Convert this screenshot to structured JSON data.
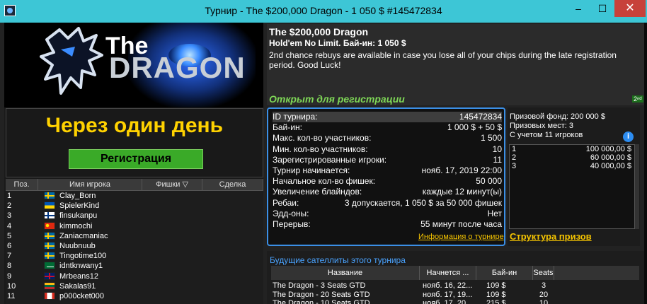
{
  "window": {
    "title": "Турнир - The $200,000 Dragon - 1 050 $ #145472834",
    "minimize": "–",
    "maximize": "☐",
    "close": "✕"
  },
  "banner": {
    "logo_the": "The",
    "logo_dragon": "DRAGON"
  },
  "countdown": "Через один день",
  "register_button": "Регистрация",
  "players": {
    "headers": [
      "Поз.",
      "Имя игрока",
      "Фишки ▽",
      "Сделка"
    ],
    "rows": [
      {
        "pos": "1",
        "name": "Clay_Born",
        "flag": "sweden"
      },
      {
        "pos": "2",
        "name": "SpielerKind",
        "flag": "ukraine"
      },
      {
        "pos": "3",
        "name": "finsukanpu",
        "flag": "finland"
      },
      {
        "pos": "4",
        "name": "kimmochi",
        "flag": "china"
      },
      {
        "pos": "5",
        "name": "Zaniacmaniac",
        "flag": "sweden"
      },
      {
        "pos": "6",
        "name": "Nuubnuub",
        "flag": "sweden"
      },
      {
        "pos": "7",
        "name": "Tingotime100",
        "flag": "sweden"
      },
      {
        "pos": "8",
        "name": "idntknwany1",
        "flag": "saudi-arabia"
      },
      {
        "pos": "9",
        "name": "Mrbeans12",
        "flag": "united-kingdom"
      },
      {
        "pos": "10",
        "name": "Sakalas91",
        "flag": "lithuania"
      },
      {
        "pos": "11",
        "name": "p000cket000",
        "flag": "canada"
      }
    ]
  },
  "tournament": {
    "name": "The $200,000 Dragon",
    "game": "Hold'em No Limit. Бай-ин: 1 050 $",
    "description": "2nd chance rebuys are available in case you lose all of your chips during the late registration period. Good Luck!",
    "status": "Открыт для регистрации",
    "badge": "2ⁿᵈ"
  },
  "details": [
    {
      "k": "ID турнира:",
      "v": "145472834"
    },
    {
      "k": "Бай-ин:",
      "v": "1 000 $ + 50 $"
    },
    {
      "k": "Макс. кол-во участников:",
      "v": "1 500"
    },
    {
      "k": "Мин. кол-во участников:",
      "v": "10"
    },
    {
      "k": "Зарегистрированные игроки:",
      "v": "11"
    },
    {
      "k": "Турнир начинается:",
      "v": "нояб. 17, 2019 22:00"
    },
    {
      "k": "Начальное кол-во фишек:",
      "v": "50 000"
    },
    {
      "k": "Увеличение блайндов:",
      "v": "каждые 12 минут(ы)"
    },
    {
      "k": "Ребаи:",
      "v": "3 допускается, 1 050 $ за 50 000 фишек"
    },
    {
      "k": "Эдд-оны:",
      "v": "Нет"
    },
    {
      "k": "Перерыв:",
      "v": "55 минут после часа"
    }
  ],
  "tournament_info_link": "Информация о турнире",
  "prizes": {
    "pool": "Призовой фонд: 200 000 $",
    "places": "Призовых мест: 3",
    "count_note": "С учетом 11 игроков",
    "rows": [
      {
        "place": "1",
        "amount": "100 000,00 $"
      },
      {
        "place": "2",
        "amount": "60 000,00 $"
      },
      {
        "place": "3",
        "amount": "40 000,00 $"
      }
    ],
    "structure_link": "Структура призов"
  },
  "satellites": {
    "title": "Будущие сателлиты этого турнира",
    "headers": [
      "Название",
      "Начнется ...",
      "Бай-ин",
      "Seats"
    ],
    "rows": [
      {
        "name": "The Dragon - 3 Seats GTD",
        "start": "нояб. 16, 22...",
        "buyin": "109 $",
        "seats": "3"
      },
      {
        "name": "The Dragon - 20 Seats GTD",
        "start": "нояб. 17, 19...",
        "buyin": "109 $",
        "seats": "20"
      },
      {
        "name": "The Dragon - 10 Seats GTD",
        "start": "нояб. 17, 20...",
        "buyin": "215 $",
        "seats": "10"
      }
    ]
  },
  "colors": {
    "titlebar": "#3dc6d6",
    "accent_yellow": "#ffd200",
    "register_green": "#3aaa28",
    "status_green": "#7fd857",
    "link_blue": "#4aa3ff",
    "details_border": "#3b8fe6"
  }
}
